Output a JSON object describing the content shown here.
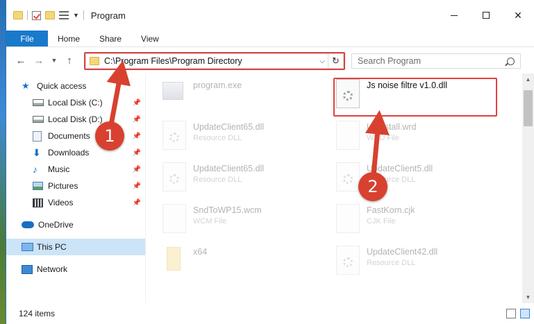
{
  "window": {
    "title": "Program"
  },
  "ribbon": {
    "file": "File",
    "tabs": [
      "Home",
      "Share",
      "View"
    ]
  },
  "address": {
    "path": "C:\\Program Files\\Program Directory"
  },
  "search": {
    "placeholder": "Search Program"
  },
  "nav": {
    "quick_access": "Quick access",
    "items": [
      {
        "label": "Local Disk (C:)",
        "icon": "disk-icon"
      },
      {
        "label": "Local Disk (D:)",
        "icon": "disk-icon"
      },
      {
        "label": "Documents",
        "icon": "documents-icon"
      },
      {
        "label": "Downloads",
        "icon": "download-icon"
      },
      {
        "label": "Music",
        "icon": "music-icon"
      },
      {
        "label": "Pictures",
        "icon": "pictures-icon"
      },
      {
        "label": "Videos",
        "icon": "videos-icon"
      }
    ],
    "onedrive": "OneDrive",
    "this_pc": "This PC",
    "network": "Network"
  },
  "files": {
    "highlighted": {
      "name": "Js noise filtre v1.0.dll"
    },
    "items": [
      {
        "name": "program.exe",
        "type": ""
      },
      {
        "name": "UpdateClient65.dll",
        "type": "Resource DLL"
      },
      {
        "name": "Uninstall.wrd",
        "type": "WRD File"
      },
      {
        "name": "UpdateClient65.dll",
        "type": "Resource DLL"
      },
      {
        "name": "UpdateClient5.dll",
        "type": "Resource DLL"
      },
      {
        "name": "SndToWP15.wcm",
        "type": "WCM File"
      },
      {
        "name": "FastKorn.cjk",
        "type": "CJK File"
      },
      {
        "name": "x64",
        "type": ""
      },
      {
        "name": "UpdateClient42.dll",
        "type": "Resource DLL"
      }
    ]
  },
  "status": {
    "count": "124 items"
  },
  "callouts": {
    "one": "1",
    "two": "2"
  },
  "colors": {
    "accent": "#1979ca",
    "highlight": "#e04040",
    "callout": "#d8412f"
  }
}
